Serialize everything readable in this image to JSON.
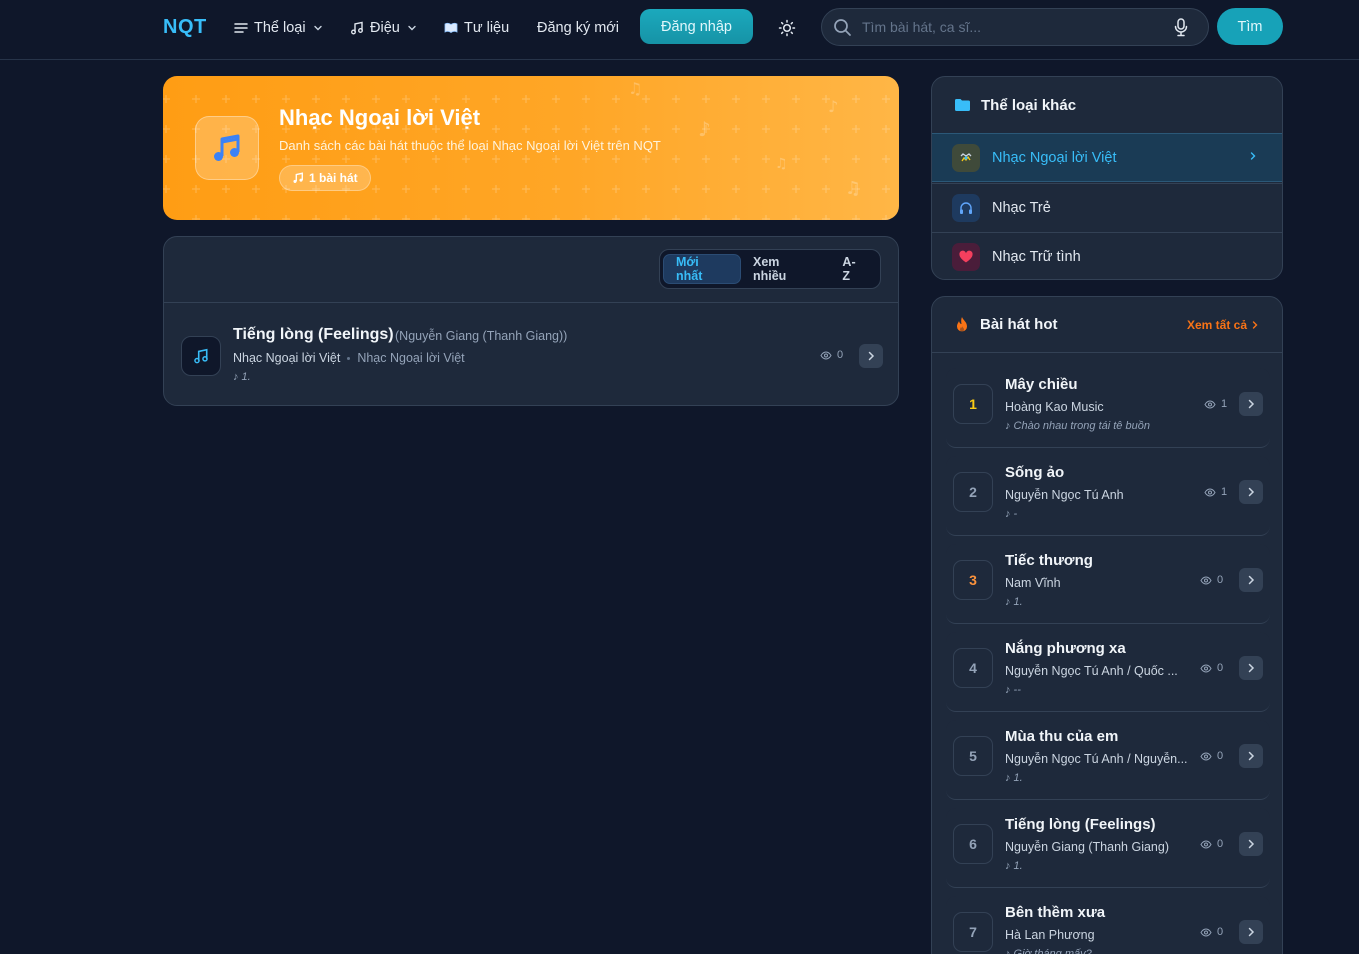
{
  "header": {
    "logo": "NQT",
    "nav": {
      "genres": "Thể loại",
      "tunes": "Điệu",
      "docs": "Tư liệu",
      "register": "Đăng ký mới"
    },
    "login": "Đăng nhập",
    "search_placeholder": "Tìm bài hát, ca sĩ...",
    "search_button": "Tìm"
  },
  "hero": {
    "title": "Nhạc Ngoại lời Việt",
    "subtitle": "Danh sách các bài hát thuộc thể loại Nhạc Ngoại lời Việt trên NQT",
    "badge": "1 bài hát",
    "accent": "#ffa020"
  },
  "sort_tabs": [
    "Mới nhất",
    "Xem nhiều",
    "A-Z"
  ],
  "songs": [
    {
      "title": "Tiếng lòng (Feelings)",
      "artist": "(Nguyễn Giang (Thanh Giang))",
      "category": "Nhạc Ngoại lời Việt",
      "category2": "Nhạc Ngoại lời Việt",
      "lyric": "♪ 1.",
      "views": "0"
    }
  ],
  "sidebar": {
    "genres_title": "Thể loại khác",
    "genres": [
      {
        "label": "Nhạc Ngoại lời Việt",
        "active": true,
        "icon": "globe-music-icon"
      },
      {
        "label": "Nhạc Trẻ",
        "active": false,
        "icon": "headphones-icon"
      },
      {
        "label": "Nhạc Trữ tình",
        "active": false,
        "icon": "heart-icon"
      }
    ],
    "hot_title": "Bài hát hot",
    "see_all": "Xem tất cả",
    "hot": [
      {
        "rank": "1",
        "title": "Mây chiều",
        "artist": "Hoàng Kao Music",
        "lyric": "♪ Chào nhau trong tái tê buồn",
        "views": "1"
      },
      {
        "rank": "2",
        "title": "Sống ảo",
        "artist": "Nguyễn Ngọc Tú Anh",
        "lyric": "♪ -",
        "views": "1"
      },
      {
        "rank": "3",
        "title": "Tiếc thương",
        "artist": "Nam Vĩnh",
        "lyric": "♪ 1.",
        "views": "0"
      },
      {
        "rank": "4",
        "title": "Nắng phương xa",
        "artist": "Nguyễn Ngọc Tú Anh / Quốc ...",
        "lyric": "♪ --",
        "views": "0"
      },
      {
        "rank": "5",
        "title": "Mùa thu của em",
        "artist": "Nguyễn Ngọc Tú Anh / Nguyễn...",
        "lyric": "♪ 1.",
        "views": "0"
      },
      {
        "rank": "6",
        "title": "Tiếng lòng (Feelings)",
        "artist": "Nguyễn Giang (Thanh Giang)",
        "lyric": "♪ 1.",
        "views": "0"
      },
      {
        "rank": "7",
        "title": "Bên thềm xưa",
        "artist": "Hà Lan Phương",
        "lyric": "♪ Giờ tháng mấy?",
        "views": "0"
      }
    ]
  }
}
